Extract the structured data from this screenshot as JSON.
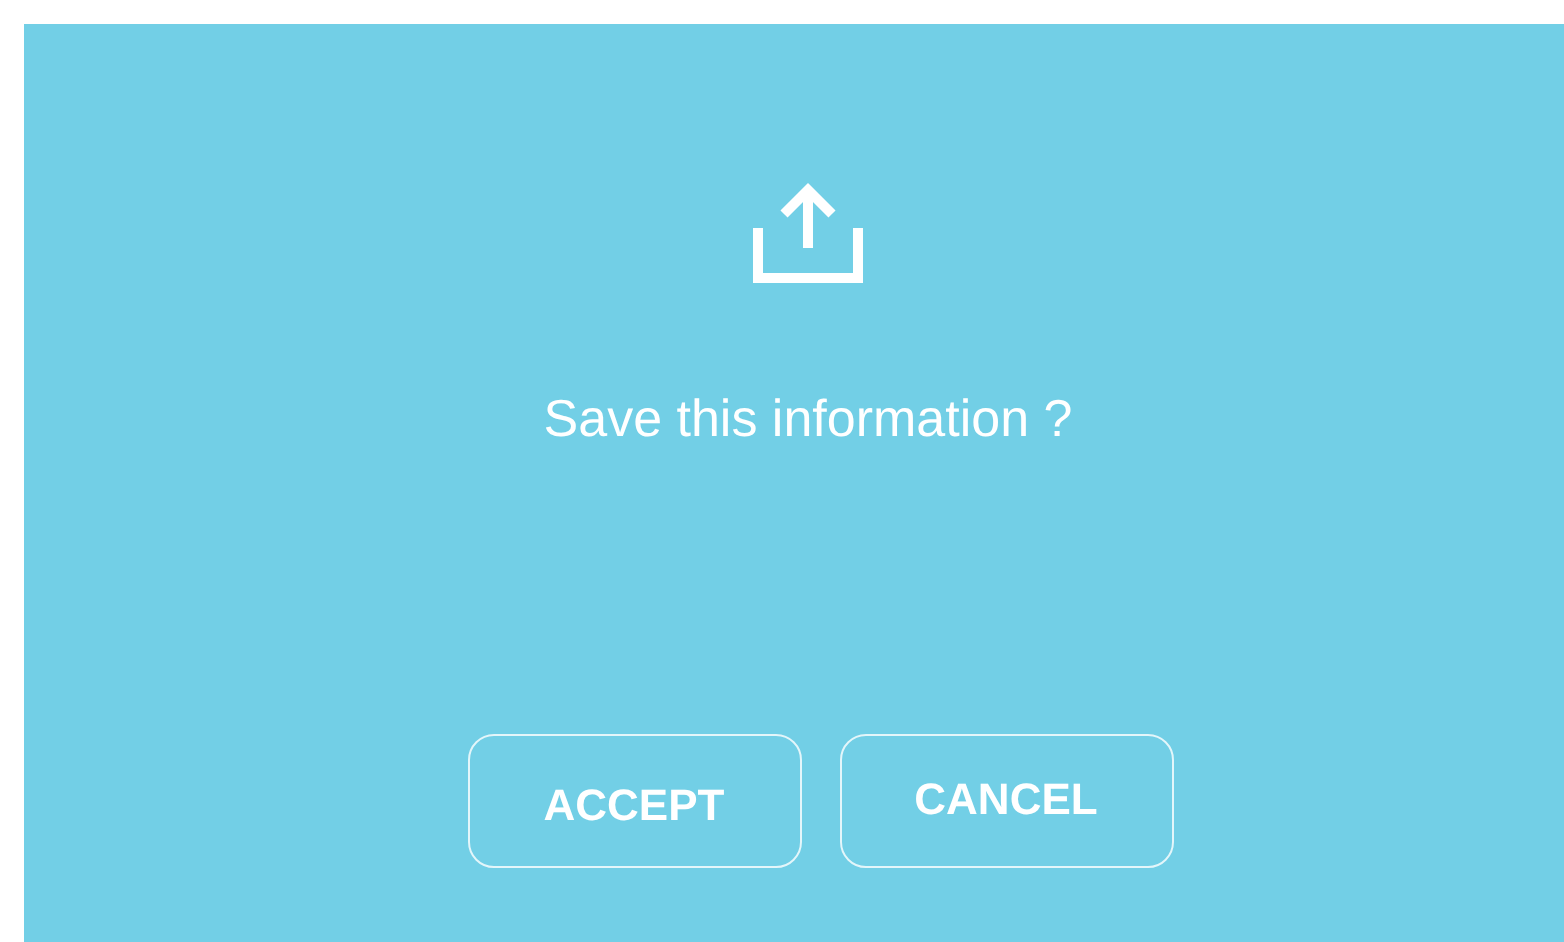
{
  "dialog": {
    "message": "Save this information ?",
    "buttons": [
      {
        "label": "ACCEPT",
        "kind": "accept"
      },
      {
        "label": "CANCEL",
        "kind": "cancel"
      }
    ]
  }
}
